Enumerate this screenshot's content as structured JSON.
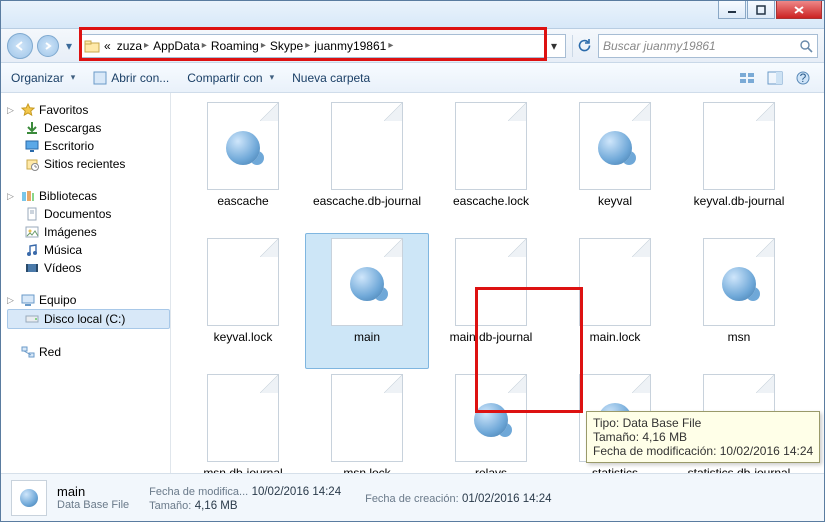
{
  "breadcrumb": {
    "prefix": "«",
    "items": [
      "zuza",
      "AppData",
      "Roaming",
      "Skype",
      "juanmy19861"
    ]
  },
  "search": {
    "placeholder": "Buscar juanmy19861"
  },
  "toolbar": {
    "organize": "Organizar",
    "openwith": "Abrir con...",
    "share": "Compartir con",
    "newfolder": "Nueva carpeta"
  },
  "sidebar": {
    "favorites": {
      "label": "Favoritos",
      "items": [
        "Descargas",
        "Escritorio",
        "Sitios recientes"
      ]
    },
    "libraries": {
      "label": "Bibliotecas",
      "items": [
        "Documentos",
        "Imágenes",
        "Música",
        "Vídeos"
      ]
    },
    "computer": {
      "label": "Equipo",
      "items": [
        "Disco local (C:)"
      ]
    },
    "network": {
      "label": "Red"
    }
  },
  "files": [
    {
      "name": "eascache",
      "icon": "gear"
    },
    {
      "name": "eascache.db-journal",
      "icon": "blank"
    },
    {
      "name": "eascache.lock",
      "icon": "blank"
    },
    {
      "name": "keyval",
      "icon": "gear"
    },
    {
      "name": "keyval.db-journal",
      "icon": "blank"
    },
    {
      "name": "keyval.lock",
      "icon": "blank"
    },
    {
      "name": "main",
      "icon": "gear",
      "selected": true
    },
    {
      "name": "main.db-journal",
      "icon": "blank"
    },
    {
      "name": "main.lock",
      "icon": "blank"
    },
    {
      "name": "msn",
      "icon": "gear"
    },
    {
      "name": "msn.db-journal",
      "icon": "blank"
    },
    {
      "name": "msn.lock",
      "icon": "blank"
    },
    {
      "name": "relays",
      "icon": "gear"
    },
    {
      "name": "statistics",
      "icon": "gear"
    },
    {
      "name": "statistics.db-journal",
      "icon": "blank"
    }
  ],
  "tooltip": {
    "line1_label": "Tipo:",
    "line1_value": "Data Base File",
    "line2_label": "Tamaño:",
    "line2_value": "4,16 MB",
    "line3_label": "Fecha de modificación:",
    "line3_value": "10/02/2016 14:24"
  },
  "status": {
    "name": "main",
    "type": "Data Base File",
    "mod_label": "Fecha de modifica...",
    "mod_value": "10/02/2016 14:24",
    "size_label": "Tamaño:",
    "size_value": "4,16 MB",
    "created_label": "Fecha de creación:",
    "created_value": "01/02/2016 14:24"
  }
}
